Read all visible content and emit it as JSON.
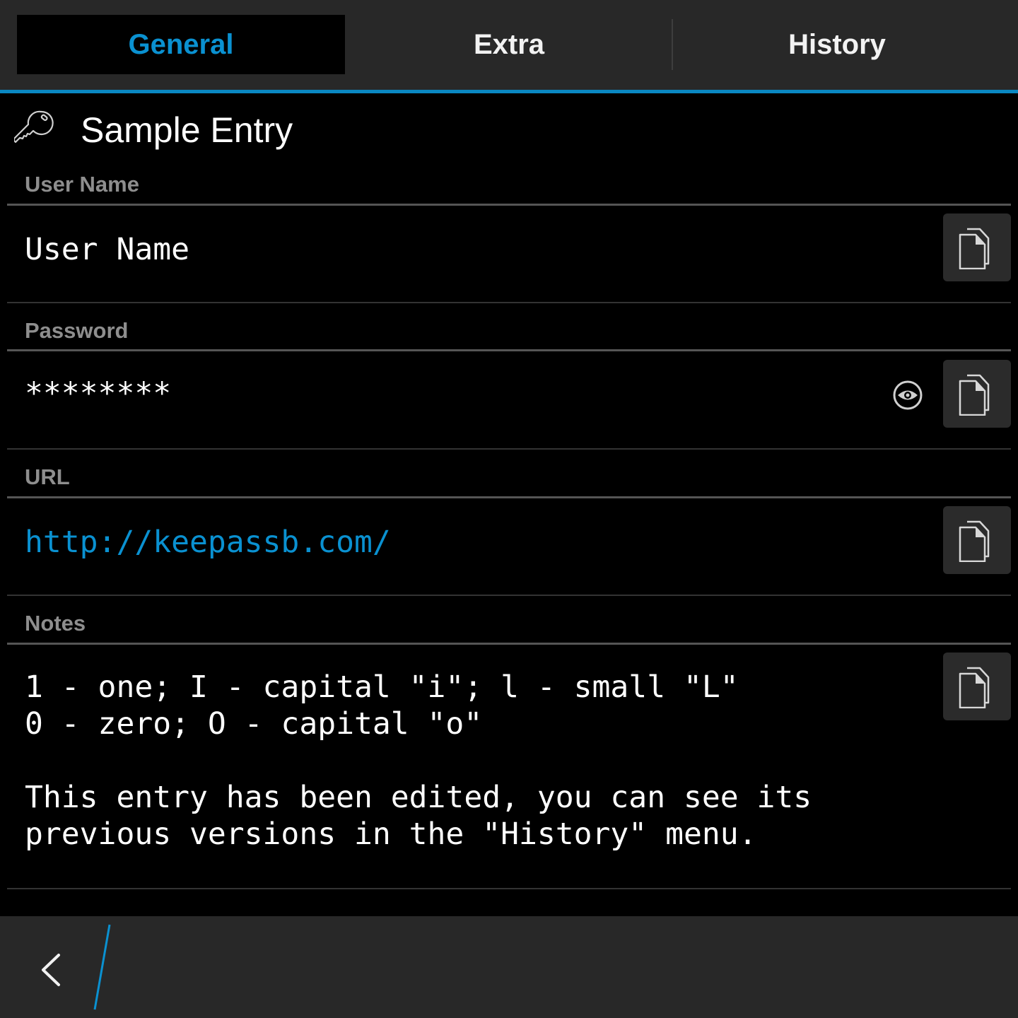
{
  "tabs": [
    {
      "label": "General",
      "active": true
    },
    {
      "label": "Extra",
      "active": false
    },
    {
      "label": "History",
      "active": false
    }
  ],
  "entry": {
    "icon": "key-icon",
    "title": "Sample Entry"
  },
  "fields": {
    "username": {
      "label": "User Name",
      "value": "User Name",
      "copy_icon": "copy-icon"
    },
    "password": {
      "label": "Password",
      "value": "********",
      "reveal_icon": "eye-icon",
      "copy_icon": "copy-icon"
    },
    "url": {
      "label": "URL",
      "value": "http://keepassb.com/",
      "copy_icon": "copy-icon"
    },
    "notes": {
      "label": "Notes",
      "value": "1 - one; I - capital \"i\"; l - small \"L\"\n0 - zero; O - capital \"o\"\n\nThis entry has been edited, you can see its\nprevious versions in the \"History\" menu.",
      "copy_icon": "copy-icon"
    }
  },
  "bottom_bar": {
    "back_icon": "chevron-left-icon"
  },
  "colors": {
    "accent": "#0a91d1",
    "bar_bg": "#282828",
    "label": "#8e8e8e"
  }
}
